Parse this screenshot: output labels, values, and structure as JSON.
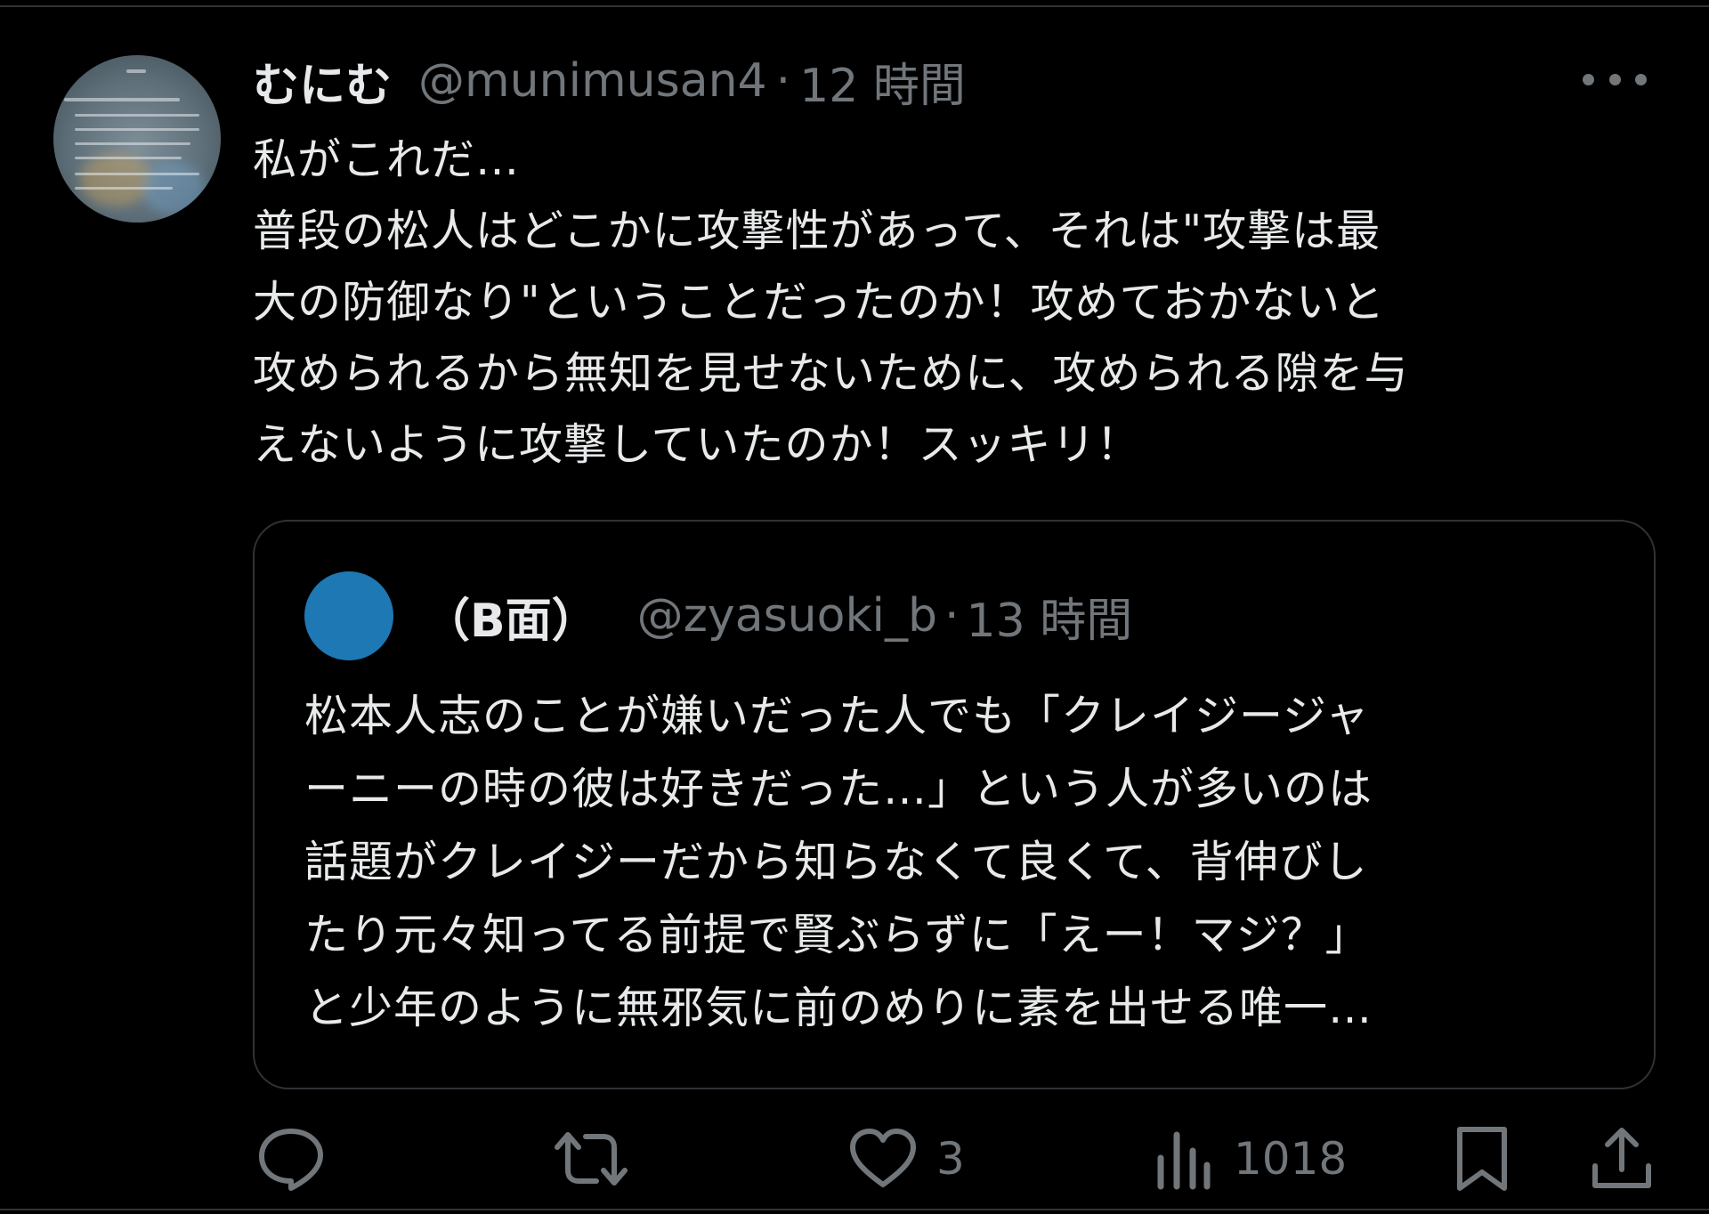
{
  "tweet": {
    "display_name": "むにむ",
    "handle": "@munimusan4",
    "separator": "·",
    "time": "12 時間",
    "text_lines": [
      "私がこれだ…",
      "普段の松人はどこかに攻撃性があって、それは\"攻撃は最",
      "大の防御なり\"ということだったのか！攻めておかないと",
      "攻められるから無知を見せないために、攻められる隙を与",
      "えないように攻撃していたのか！スッキリ！"
    ]
  },
  "quote": {
    "display_name": "（B面）",
    "handle": "@zyasuoki_b",
    "separator": "·",
    "time": "13 時間",
    "text_lines": [
      "松本人志のことが嫌いだった人でも「クレイジージャ",
      "ーニーの時の彼は好きだった…」という人が多いのは",
      "話題がクレイジーだから知らなくて良くて、背伸びし",
      "たり元々知ってる前提で賢ぶらずに「えー！マジ？」",
      "と少年のように無邪気に前のめりに素を出せる唯一…"
    ],
    "avatar_color": "#1d78b4"
  },
  "actions": {
    "reply_icon": "reply-icon",
    "retweet_icon": "retweet-icon",
    "like_icon": "heart-icon",
    "like_count": "3",
    "views_icon": "views-icon",
    "views_count": "1018",
    "bookmark_icon": "bookmark-icon",
    "share_icon": "share-icon"
  },
  "colors": {
    "background": "#000000",
    "text": "#e7e9ea",
    "secondary": "#71767b",
    "border": "#2f3336"
  }
}
